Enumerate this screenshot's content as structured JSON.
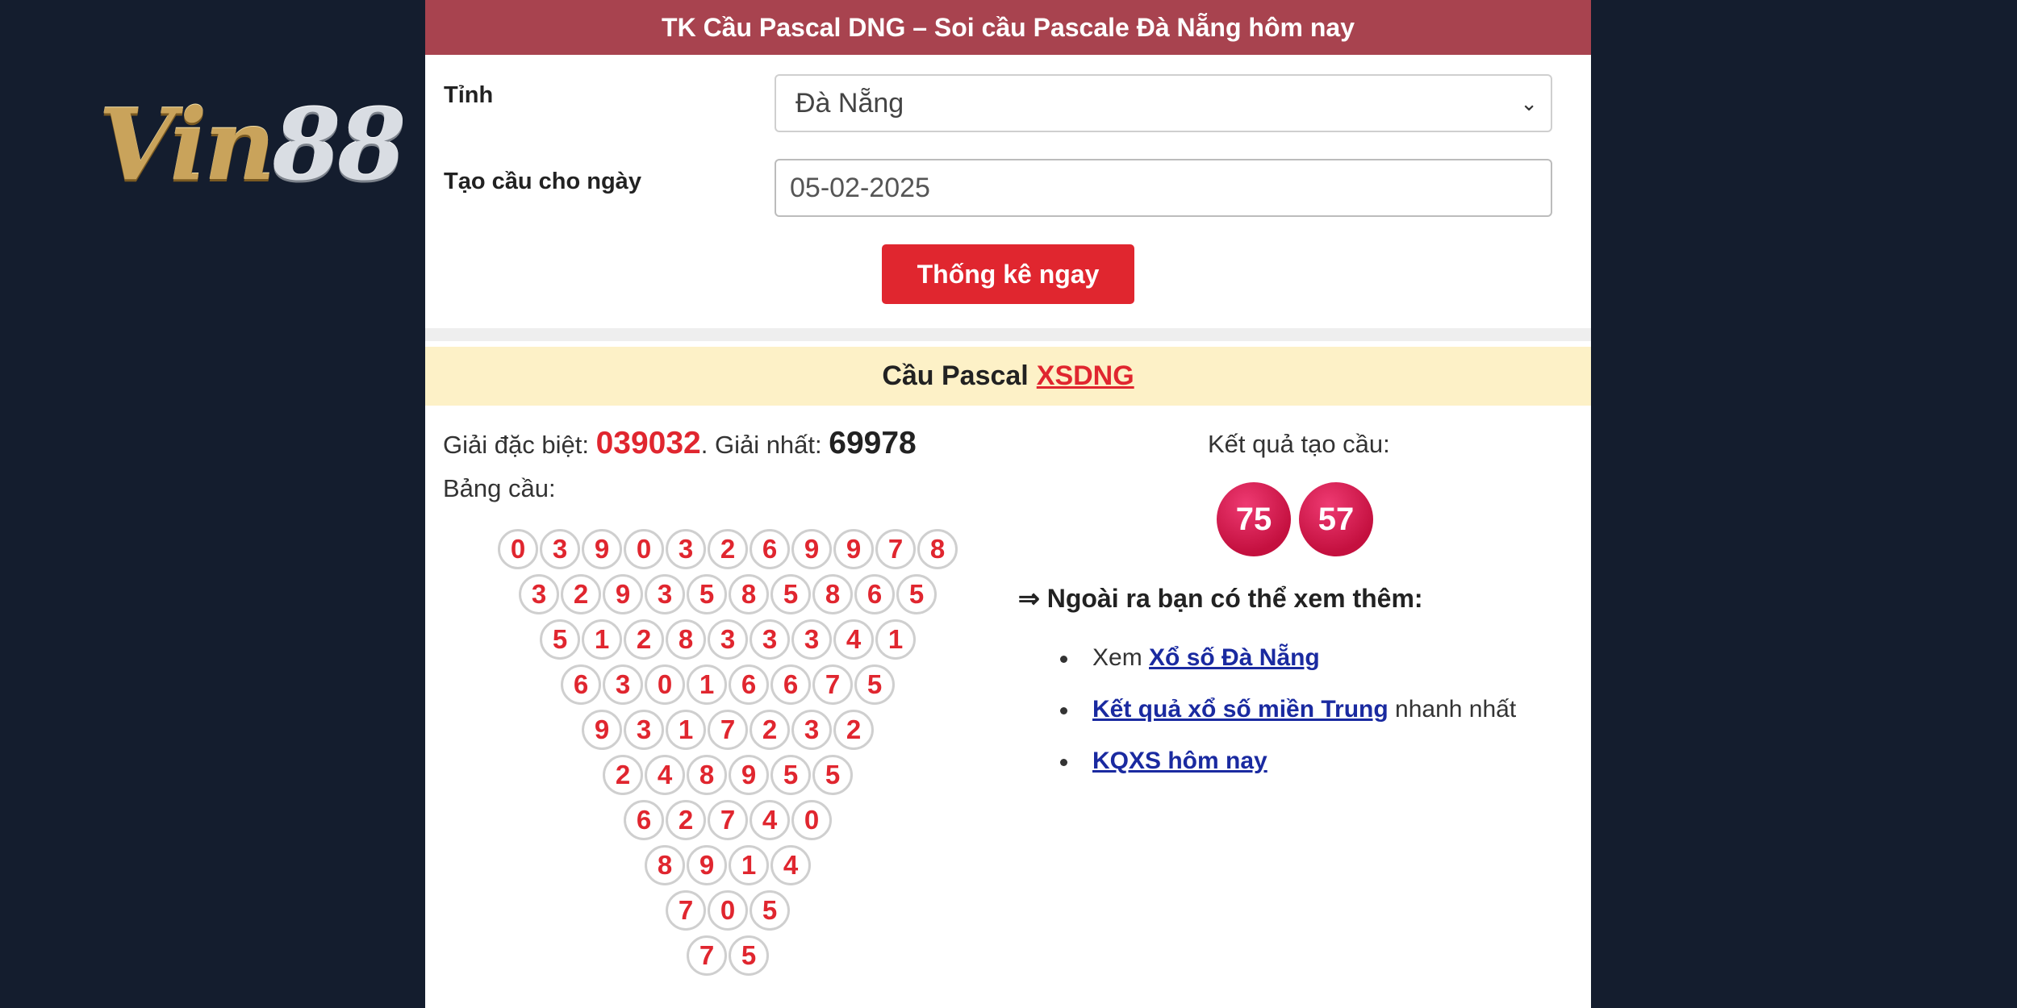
{
  "logo": {
    "part1": "Vin",
    "part2": "88"
  },
  "header": {
    "title": "TK Cầu Pascal DNG – Soi cầu Pascale Đà Nẵng hôm nay"
  },
  "form": {
    "province_label": "Tỉnh",
    "province_value": "Đà Nẵng",
    "date_label": "Tạo cầu cho ngày",
    "date_value": "05-02-2025",
    "submit_label": "Thống kê ngay"
  },
  "section": {
    "title": "Cầu Pascal",
    "link": "XSDNG"
  },
  "prizes": {
    "special_label": "Giải đặc biệt:",
    "special_value": "039032",
    "separator": ".",
    "first_label": "Giải nhất:",
    "first_value": "69978",
    "table_label": "Bảng cầu:"
  },
  "pascal_rows": [
    [
      "0",
      "3",
      "9",
      "0",
      "3",
      "2",
      "6",
      "9",
      "9",
      "7",
      "8"
    ],
    [
      "3",
      "2",
      "9",
      "3",
      "5",
      "8",
      "5",
      "8",
      "6",
      "5"
    ],
    [
      "5",
      "1",
      "2",
      "8",
      "3",
      "3",
      "3",
      "4",
      "1"
    ],
    [
      "6",
      "3",
      "0",
      "1",
      "6",
      "6",
      "7",
      "5"
    ],
    [
      "9",
      "3",
      "1",
      "7",
      "2",
      "3",
      "2"
    ],
    [
      "2",
      "4",
      "8",
      "9",
      "5",
      "5"
    ],
    [
      "6",
      "2",
      "7",
      "4",
      "0"
    ],
    [
      "8",
      "9",
      "1",
      "4"
    ],
    [
      "7",
      "0",
      "5"
    ],
    [
      "7",
      "5"
    ]
  ],
  "result": {
    "label": "Kết quả tạo cầu:",
    "values": [
      "75",
      "57"
    ]
  },
  "more": {
    "heading": "⇒ Ngoài ra bạn có thể xem thêm:",
    "items": [
      {
        "prefix": "Xem ",
        "link": "Xổ số Đà Nẵng",
        "suffix": ""
      },
      {
        "prefix": "",
        "link": "Kết quả xổ số miền Trung",
        "suffix": " nhanh nhất"
      },
      {
        "prefix": "",
        "link": "KQXS hôm nay",
        "suffix": ""
      }
    ]
  }
}
